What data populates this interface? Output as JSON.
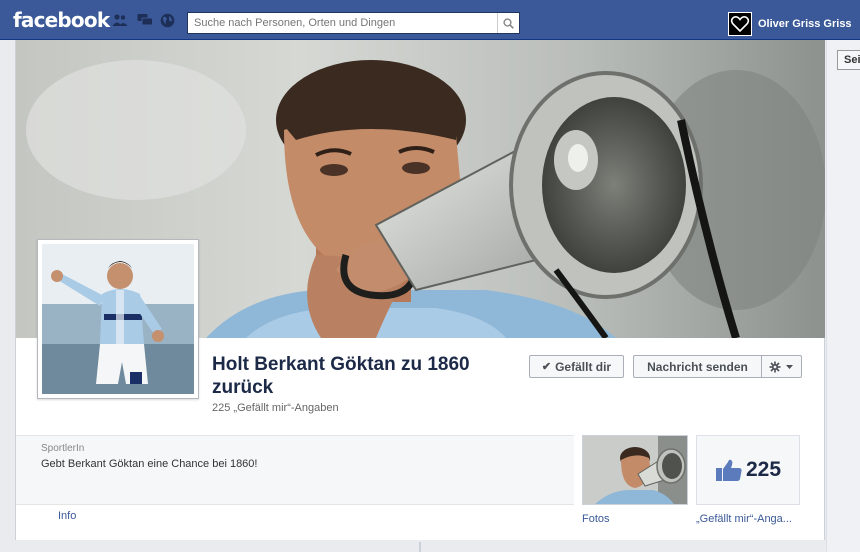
{
  "topbar": {
    "logo": "facebook",
    "search_placeholder": "Suche nach Personen, Orten und Dingen",
    "user_name": "Oliver Griss Griss",
    "brand_color": "#3b5998"
  },
  "side": {
    "button_label": "Seit"
  },
  "page": {
    "title": "Holt Berkant Göktan zu 1860 zurück",
    "likes_subtitle": "225 „Gefällt mir“-Angaben",
    "like_button_label": "Gefällt dir",
    "message_button_label": "Nachricht senden",
    "category": "SportlerIn",
    "description": "Gebt Berkant Göktan eine Chance bei 1860!",
    "info_label": "Info",
    "photos_label": "Fotos",
    "like_count": "225",
    "likes_label": "„Gefällt mir“-Anga..."
  },
  "icons": {
    "friends": "friend-requests-icon",
    "messages": "messages-icon",
    "notifications": "globe-notifications-icon",
    "search": "magnifier-icon",
    "gear": "gear-icon",
    "like": "thumbs-up-icon"
  }
}
